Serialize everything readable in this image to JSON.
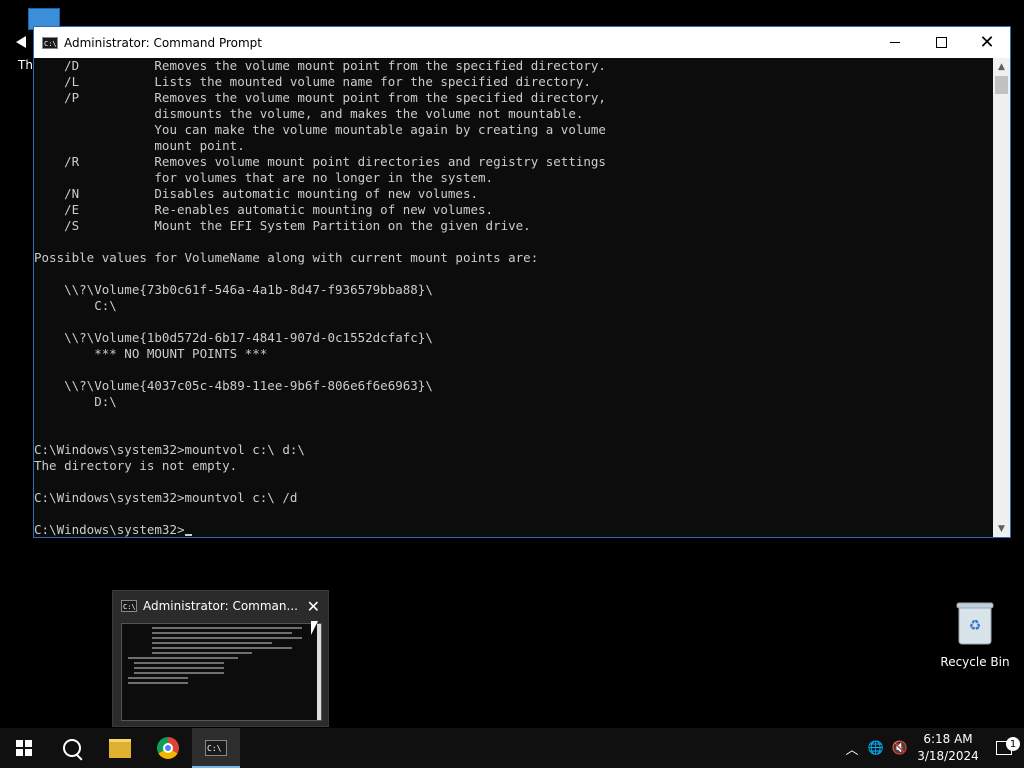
{
  "desktop": {
    "this_pc_label": "Thi",
    "recycle_bin_label": "Recycle Bin"
  },
  "window": {
    "title": "Administrator: Command Prompt",
    "console_text": "    /D          Removes the volume mount point from the specified directory.\n    /L          Lists the mounted volume name for the specified directory.\n    /P          Removes the volume mount point from the specified directory,\n                dismounts the volume, and makes the volume not mountable.\n                You can make the volume mountable again by creating a volume\n                mount point.\n    /R          Removes volume mount point directories and registry settings\n                for volumes that are no longer in the system.\n    /N          Disables automatic mounting of new volumes.\n    /E          Re-enables automatic mounting of new volumes.\n    /S          Mount the EFI System Partition on the given drive.\n\nPossible values for VolumeName along with current mount points are:\n\n    \\\\?\\Volume{73b0c61f-546a-4a1b-8d47-f936579bba88}\\\n        C:\\\n\n    \\\\?\\Volume{1b0d572d-6b17-4841-907d-0c1552dcfafc}\\\n        *** NO MOUNT POINTS ***\n\n    \\\\?\\Volume{4037c05c-4b89-11ee-9b6f-806e6f6e6963}\\\n        D:\\\n\n\nC:\\Windows\\system32>mountvol c:\\ d:\\\nThe directory is not empty.\n\nC:\\Windows\\system32>mountvol c:\\ /d\n\nC:\\Windows\\system32>",
    "icon_name": "cmd-icon"
  },
  "preview": {
    "title": "Administrator: Comman..."
  },
  "taskbar": {
    "time": "6:18 AM",
    "date": "3/18/2024",
    "notification_count": "1",
    "icons": [
      "windows-logo-icon",
      "search-icon",
      "file-explorer-icon",
      "chrome-icon",
      "cmd-icon"
    ]
  },
  "colors": {
    "console_bg": "#0c0c0c",
    "console_text": "#cccccc",
    "accent": "#2b6cb5",
    "taskbar_bg": "#101010"
  }
}
